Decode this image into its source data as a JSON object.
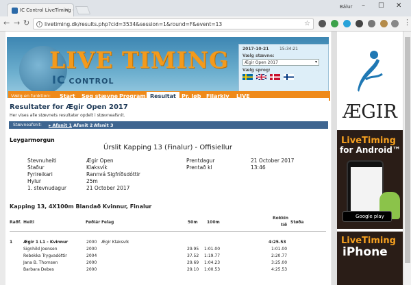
{
  "browser": {
    "tab_title": "IC Control LiveTiming - Æ",
    "user_name": "Bálur",
    "url": "livetiming.dk/results.php?cid=3534&session=1&round=F&event=13"
  },
  "header": {
    "logo_title": "LIVE TIMING",
    "logo_ic": "IC",
    "logo_control": "CONTROL",
    "date": "2017-10-21",
    "time": "15:34:21",
    "meet_label": "Vælg stævne:",
    "meet_value": "Ægir Open 2017",
    "lang_label": "Vælg sprog:"
  },
  "menu": {
    "prefix": "Vælg en funktion:",
    "items": [
      "Start",
      "Søg stævne",
      "Program",
      "Resultat",
      "Pr. løb",
      "Filarkiv",
      "LIVE"
    ],
    "active": "Resultat"
  },
  "content": {
    "title": "Resultater for Ægir Open 2017",
    "subtitle": "Her vises alle stævnets resultater opdelt i stævneafsnit.",
    "section_label": "Stævneafsnit:",
    "sections": [
      "Afsnit 1",
      "Afsnit 2",
      "Afsnit 3"
    ],
    "day": "Leygarmorgun",
    "event_title": "Úrslit Kapping 13 (Finalur) - Offisiellur",
    "meta": {
      "l1k": "Stevnuheiti",
      "l1v": "Ægir Open",
      "l2k": "Staður",
      "l2v": "Klaksvík",
      "l3k": "Fyrireikari",
      "l3v": "Rannvá Sigfríðsdóttir",
      "l4k": "Hylur",
      "l4v": "25m",
      "l5k": "1. stevnudagur",
      "l5v": "21 October 2017",
      "r1k": "Prentdagur",
      "r1v": "21 October 2017",
      "r2k": "Prentað kl",
      "r2v": "13:46"
    },
    "event_heading": "Kapping 13, 4X100m Blandað Kvinnur, Finalur",
    "columns": {
      "rank": "Raðf.",
      "name": "Heiti",
      "born": "Føðiár",
      "club": "Felag",
      "split50": "50m",
      "split100": "100m",
      "rokkin1": "Rokkin",
      "rokkin2": "tíð",
      "stoda": "Støða"
    },
    "rows": [
      {
        "rank": "1",
        "name": "Ægir 1 L1 - Kvinnur",
        "born": "2000",
        "club": "Ægir Klaksvík",
        "s50": "",
        "s100": "",
        "time": "4:25.53",
        "bold": true
      },
      {
        "rank": "",
        "name": "Signhild Joensen",
        "born": "2000",
        "club": "",
        "s50": "29.95",
        "s100": "1:01.00",
        "time": "1:01.00",
        "bold": false
      },
      {
        "rank": "",
        "name": "Rebekka Trygvadóttir",
        "born": "2004",
        "club": "",
        "s50": "37.52",
        "s100": "1:19.77",
        "time": "2:20.77",
        "bold": false
      },
      {
        "rank": "",
        "name": "Jana B. Thomsen",
        "born": "2000",
        "club": "",
        "s50": "29.69",
        "s100": "1:04.23",
        "time": "3:25.00",
        "bold": false
      },
      {
        "rank": "",
        "name": "Barbara Debes",
        "born": "2000",
        "club": "",
        "s50": "29.10",
        "s100": "1:00.53",
        "time": "4:25.53",
        "bold": false
      }
    ]
  },
  "ads": {
    "club_name": "ÆGIR",
    "android_t1": "LiveTiming",
    "android_t2": "for Android™",
    "android_store": "Google play",
    "android_store_top": "ANDROID APP ON",
    "iphone_t1": "LiveTiming",
    "iphone_t2": "iPhone"
  }
}
